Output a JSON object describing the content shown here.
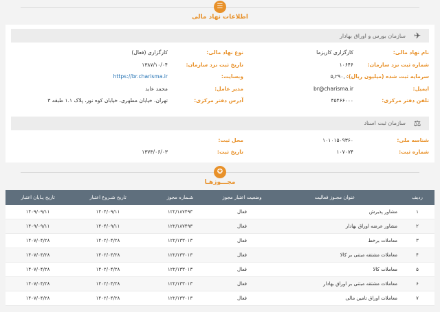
{
  "financial": {
    "title": "اطلاعات نهاد مالی",
    "icon": "list-icon",
    "org_name": "سازمان بورس و اوراق بهادار",
    "fields_left": [
      {
        "label": "نام نهاد مالی:",
        "value": "کارگزاری کاریزما"
      },
      {
        "label": "شماره ثبت نزد سازمان:",
        "value": "۱۰۶۴۶"
      },
      {
        "label": "سرمایه ثبت شده (میلیون ریال):",
        "value": "۵,۲۹۰,۰۰۰"
      },
      {
        "label": "ایمیل:",
        "value": "br@charisma.ir"
      },
      {
        "label": "تلفن دفتر مرکزی:",
        "value": "۴۵۴۶۶۰۰۰"
      }
    ],
    "fields_right": [
      {
        "label": "نوع نهاد مالی:",
        "value": "کارگزاری (فعال)"
      },
      {
        "label": "تاریخ ثبت نزد سازمان:",
        "value": "۱۳۸۷/۱۰/۰۴"
      },
      {
        "label": "وبسایت:",
        "value": "https://br.charisma.ir"
      },
      {
        "label": "مدیر عامل:",
        "value": "محمد عابد"
      },
      {
        "label": "آدرس دفتر مرکزی:",
        "value": "تهران، خیابان مطهری، خیابان کوه نور، پلاک ۱.۱ طبقه ۳"
      }
    ]
  },
  "registry": {
    "org_name": "سازمان ثبت اسناد",
    "fields_left": [
      {
        "label": "شناسه ملی:",
        "value": "۱۰۱۰۱۵۰۹۳۶۰"
      },
      {
        "label": "شماره ثبت:",
        "value": "۱۰۷۰۷۴"
      }
    ],
    "fields_right": [
      {
        "label": "محل ثبت:",
        "value": ""
      },
      {
        "label": "تاریخ ثبت:",
        "value": "۱۳۷۳/۰۶/۰۳"
      }
    ]
  },
  "licenses": {
    "title": "مجـــوزهـا",
    "icon": "certificate-icon",
    "headers": [
      "ردیف",
      "عنوان مجـوز فعالیت",
      "وضعیت اعتبار مجوز",
      "شـماره مجوز",
      "تاریخ شـروع اعتبار",
      "تاریخ پـایان اعتبار"
    ],
    "rows": [
      [
        "۱",
        "مشاور پذیرش",
        "فعال",
        "۱۲۲/۱۸۷۴۹۳",
        "۱۴۰۴/۰۹/۱۱",
        "۱۴۰۹/۰۹/۱۱"
      ],
      [
        "۲",
        "مشاور عرضه اوراق بهادار",
        "فعال",
        "۱۲۲/۱۸۷۴۹۳",
        "۱۴۰۴/۰۹/۱۱",
        "۱۴۰۹/۰۹/۱۱"
      ],
      [
        "۳",
        "معاملات برخط",
        "فعال",
        "۱۲۲/۱۳۳۰۱۳",
        "۱۴۰۲/۰۴/۲۸",
        "۱۴۰۷/۰۴/۲۸"
      ],
      [
        "۴",
        "معاملات مشتقه مبتنی بر کالا",
        "فعال",
        "۱۲۲/۱۳۳۰۱۳",
        "۱۴۰۲/۰۴/۲۸",
        "۱۴۰۷/۰۴/۲۸"
      ],
      [
        "۵",
        "معاملات کالا",
        "فعال",
        "۱۲۲/۱۳۳۰۱۳",
        "۱۴۰۲/۰۴/۲۸",
        "۱۴۰۷/۰۴/۲۸"
      ],
      [
        "۶",
        "معاملات مشتقه مبتنی بر اوراق بهادار",
        "فعال",
        "۱۲۲/۱۳۳۰۱۳",
        "۱۴۰۲/۰۴/۲۸",
        "۱۴۰۷/۰۴/۲۸"
      ],
      [
        "۷",
        "معاملات اوراق تامین مالی",
        "فعال",
        "۱۲۲/۱۳۳۰۱۳",
        "۱۴۰۲/۰۴/۲۸",
        "۱۴۰۷/۰۴/۲۸"
      ]
    ]
  },
  "colors": {
    "accent": "#e8912a",
    "header_bg": "#5f6f7d",
    "link": "#1f6fb2"
  }
}
